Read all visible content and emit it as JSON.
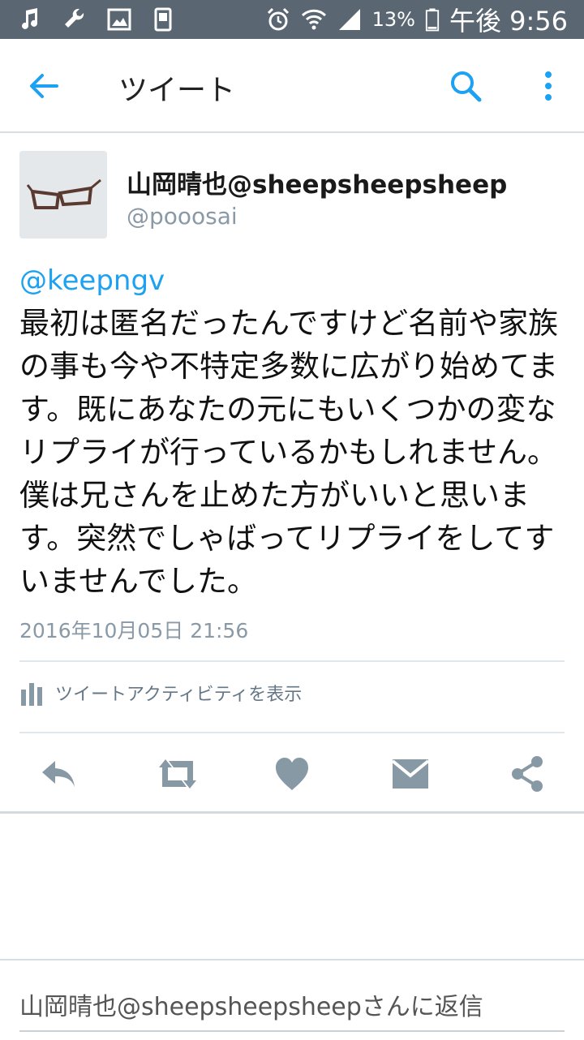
{
  "status_bar": {
    "battery_percent": "13%",
    "clock": "午後 9:56",
    "left_icons": [
      "music-note-icon",
      "wrench-icon",
      "image-icon",
      "clipboard-icon"
    ],
    "right_icons": [
      "alarm-icon",
      "wifi-icon",
      "signal-icon",
      "battery-icon"
    ]
  },
  "app_bar": {
    "title": "ツイート"
  },
  "tweet": {
    "display_name": "山岡晴也@sheepsheepsheep",
    "handle": "@pooosai",
    "mention": "@keepngv",
    "body": "最初は匿名だったんですけど名前や家族の事も今や不特定多数に広がり始めてます。既にあなたの元にもいくつかの変なリプライが行っているかもしれません。僕は兄さんを止めた方がいいと思います。突然でしゃばってリプライをしてすいませんでした。",
    "timestamp": "2016年10月05日 21:56",
    "activity_label": "ツイートアクティビティを表示"
  },
  "reply": {
    "placeholder": "山岡晴也@sheepsheepsheepさんに返信"
  },
  "colors": {
    "status_bar": "#5a6773",
    "accent": "#1da1f2",
    "action_icon": "#8899a6",
    "muted_text": "#8a99a6"
  }
}
